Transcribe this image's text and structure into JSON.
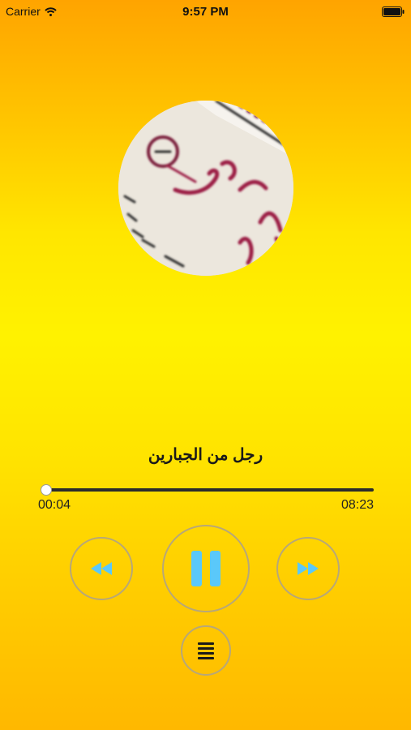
{
  "status_bar": {
    "carrier": "Carrier",
    "time": "9:57 PM"
  },
  "player": {
    "track_title": "رجل من الجبارين",
    "elapsed": "00:04",
    "duration": "08:23",
    "progress": 0.008
  },
  "icons": {
    "wifi": "wifi-icon",
    "battery": "battery-icon",
    "rewind": "rewind-icon",
    "pause": "pause-icon",
    "forward": "fast-forward-icon",
    "playlist": "list-icon"
  },
  "colors": {
    "accent": "#5AC8FA",
    "ring": "#B7A779",
    "background_top": "#FFA400",
    "background_mid": "#FFF200"
  }
}
